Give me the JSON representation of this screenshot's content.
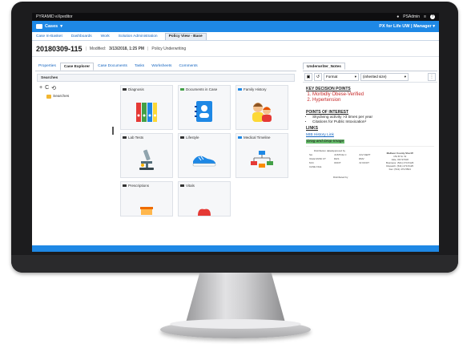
{
  "os_bar": {
    "app_title": "PYRAMID eXpeditor",
    "user": "PSAdmin",
    "help": "?"
  },
  "top_nav": {
    "cases_label": "Cases",
    "cases_caret": "▾",
    "context": "PX for Life UW | Manager",
    "context_caret": "▾"
  },
  "menu": [
    "Case In-Basket",
    "Dashboards",
    "Work",
    "Solution Administration",
    "Policy View - Base"
  ],
  "title_row": {
    "case_number": "20180309-115",
    "modified_label": "Modified:",
    "modified_value": "3/13/2018, 1:25 PM",
    "type": "Policy Underwriting"
  },
  "left_tabs": [
    "Properties",
    "Case Explorer",
    "Case Documents",
    "Tasks",
    "Worksheets",
    "Comments"
  ],
  "searches": {
    "header": "Searches",
    "folder": "Searches",
    "tools": [
      "+",
      "C",
      "⟲"
    ]
  },
  "tiles": [
    {
      "label": "Diagnosis",
      "icon": "folder-dark-icon",
      "color": "#333333"
    },
    {
      "label": "Documents in Case",
      "icon": "folder-green-icon",
      "color": "#43a047"
    },
    {
      "label": "Family History",
      "icon": "doc-blue-icon",
      "color": "#1e88e5"
    },
    {
      "label": "Lab Tests",
      "icon": "folder-dark-icon",
      "color": "#333333"
    },
    {
      "label": "Lifestyle",
      "icon": "folder-dark-icon",
      "color": "#333333"
    },
    {
      "label": "Medical Timeline",
      "icon": "doc-blue-icon",
      "color": "#1e88e5"
    },
    {
      "label": "Prescriptions",
      "icon": "folder-dark-icon",
      "color": "#333333"
    },
    {
      "label": "Vitals",
      "icon": "folder-dark-icon",
      "color": "#333333"
    }
  ],
  "right_pane": {
    "tab": "Underwriter_Notes",
    "format_label": "Format",
    "size_label": "(inherited size)",
    "key_points_title": "KEY DECISION POINTS",
    "key_points": [
      "Morbidly Obese-Verified",
      "Hypertension"
    ],
    "interest_title": "POINTS OF INTEREST",
    "interest": [
      "Skydiving activity >3 times per year",
      "Citations for Public Intoxication²"
    ],
    "links_title": "LINKS",
    "mib_link": "MIB History Link",
    "drag_drop": "Drag and Drop Image",
    "doc_lines": {
      "dist": "Distribution data/approved by",
      "checks": [
        "SA",
        "JUSTICE C",
        "JUV DEPT",
        "VALE MUNI CT",
        "DHS",
        "DMV",
        "M.D.",
        "ODOT",
        "JV DOOT",
        "CASE FILE"
      ],
      "distributed": "Distributed by",
      "sheriff": "Malheur County Sheriff",
      "addr1": "151 B St. W",
      "addr2": "Vale, OR 97918",
      "business": "Business: (541) 473-5126",
      "dispatch": "Dispatch: (541) 473-5125",
      "fax": "Fax: (541) 473-5504"
    }
  },
  "colors": {
    "accent": "#1e88e5",
    "danger": "#c62828",
    "highlight": "#66bb6a"
  }
}
